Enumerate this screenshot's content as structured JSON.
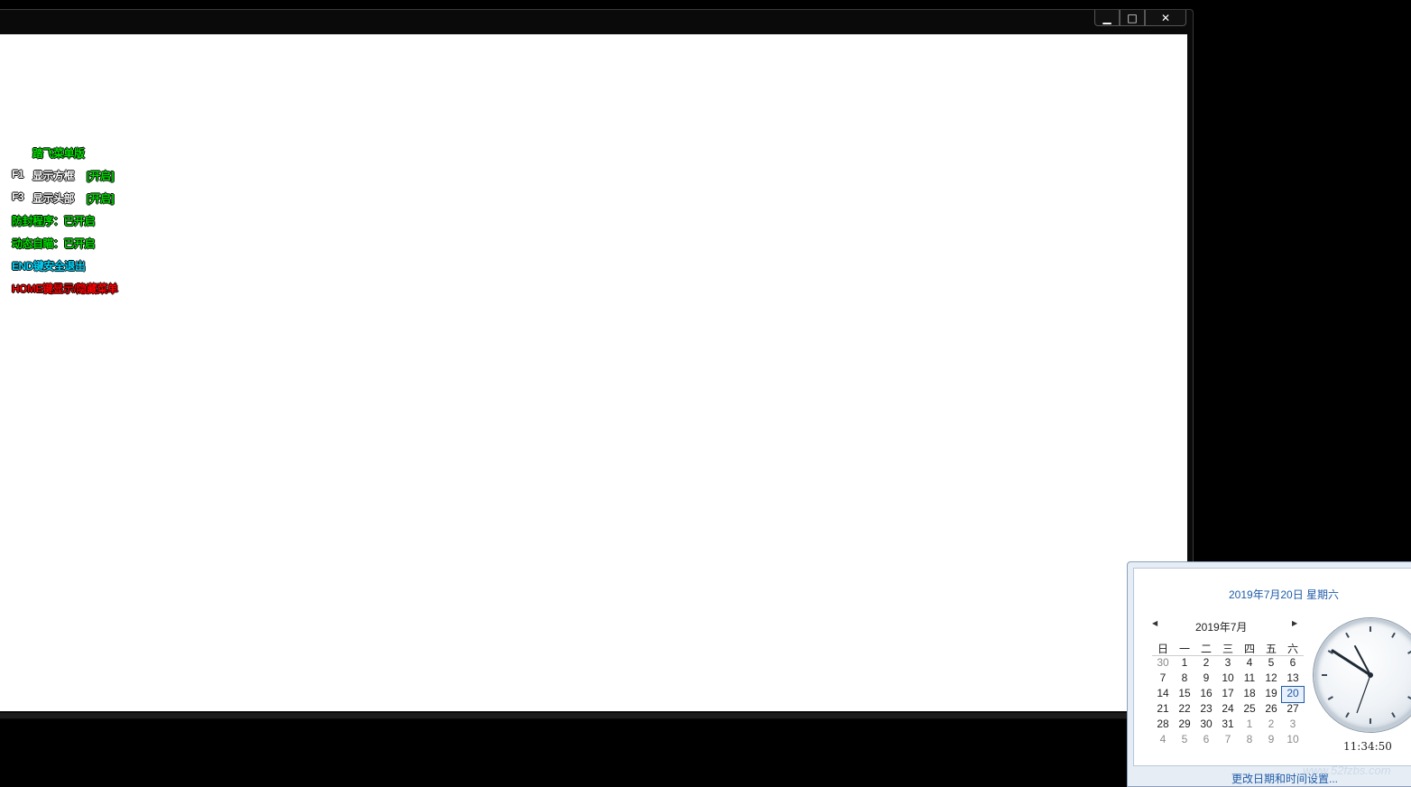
{
  "window": {
    "caption_buttons": {
      "minimize": "▁",
      "maximize": "□",
      "close": "✕"
    }
  },
  "overlay_menu": {
    "title": "踏飞菜单版",
    "f1_key": "F1",
    "f1_label": "显示方框",
    "f1_state": "[开启]",
    "f3_key": "F3",
    "f3_label": "显示头部",
    "f3_state": "[开启]",
    "anti_ban": "防封程序：已开启",
    "aim": "动态自瞄：已开启",
    "end_hint": "END键安全退出",
    "home_hint": "HOME键显示/隐藏菜单",
    "colors": {
      "green": "#00e000",
      "cyan": "#00d8ff",
      "red": "#ff0000",
      "white": "#ffffff"
    }
  },
  "clock_flyout": {
    "date_header": "2019年7月20日 星期六",
    "month_label": "2019年7月",
    "prev_icon": "◀",
    "next_icon": "▶",
    "weekdays": [
      "日",
      "一",
      "二",
      "三",
      "四",
      "五",
      "六"
    ],
    "days": [
      {
        "d": "30",
        "other": true
      },
      {
        "d": "1"
      },
      {
        "d": "2"
      },
      {
        "d": "3"
      },
      {
        "d": "4"
      },
      {
        "d": "5"
      },
      {
        "d": "6"
      },
      {
        "d": "7"
      },
      {
        "d": "8"
      },
      {
        "d": "9"
      },
      {
        "d": "10"
      },
      {
        "d": "11"
      },
      {
        "d": "12"
      },
      {
        "d": "13"
      },
      {
        "d": "14"
      },
      {
        "d": "15"
      },
      {
        "d": "16"
      },
      {
        "d": "17"
      },
      {
        "d": "18"
      },
      {
        "d": "19"
      },
      {
        "d": "20",
        "today": true
      },
      {
        "d": "21"
      },
      {
        "d": "22"
      },
      {
        "d": "23"
      },
      {
        "d": "24"
      },
      {
        "d": "25"
      },
      {
        "d": "26"
      },
      {
        "d": "27"
      },
      {
        "d": "28"
      },
      {
        "d": "29"
      },
      {
        "d": "30"
      },
      {
        "d": "31"
      },
      {
        "d": "1",
        "other": true
      },
      {
        "d": "2",
        "other": true
      },
      {
        "d": "3",
        "other": true
      },
      {
        "d": "4",
        "other": true
      },
      {
        "d": "5",
        "other": true
      },
      {
        "d": "6",
        "other": true
      },
      {
        "d": "7",
        "other": true
      },
      {
        "d": "8",
        "other": true
      },
      {
        "d": "9",
        "other": true
      },
      {
        "d": "10",
        "other": true
      }
    ],
    "time": "11:34:50",
    "footer_link": "更改日期和时间设置..."
  },
  "watermark": "www.52fzbs.com"
}
